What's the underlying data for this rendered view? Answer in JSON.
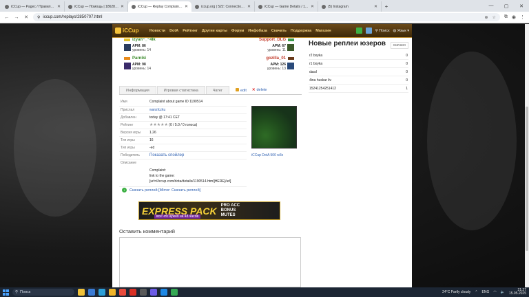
{
  "browser": {
    "tabs": [
      {
        "title": "iCCup — Pagec / Правила игр...",
        "active": false
      },
      {
        "title": "iCCup — Помощь | 1862858",
        "active": false
      },
      {
        "title": "iCCup — Replay Complaint ab...",
        "active": true
      },
      {
        "title": "iccup.org | 522: Connection tim...",
        "active": false
      },
      {
        "title": "iCCup — Game Details / 1190...",
        "active": false
      },
      {
        "title": "(5) Instagram",
        "active": false
      }
    ],
    "url": "iccup.com/replays/2850707.html"
  },
  "site": {
    "logo": "iCCup",
    "nav": [
      "Новости",
      "DotA",
      "Рейтинг",
      "Другие карты",
      "Форум",
      "Инфобаза",
      "Скачать",
      "Поддержка",
      "Магазин"
    ],
    "search_label": "Поиск",
    "lang_label": "Язык"
  },
  "players": {
    "left": [
      {
        "name": "izyan~_~4lk",
        "apm": "APM: 86",
        "level": "уровень: 14"
      },
      {
        "name": "Parniki",
        "apm": "APM: 98",
        "level": "уровень: 14"
      }
    ],
    "right": [
      {
        "name": "Support_DLG",
        "apm": "APM: 67",
        "level": "уровень: 11"
      },
      {
        "name": "gozilla_01",
        "apm": "APM: 126",
        "level": "уровень: 13"
      }
    ]
  },
  "tabs": {
    "info": "Информация",
    "stats": "Игровая статистика",
    "chat": "Чатег",
    "edit": "edit",
    "delete": "delete"
  },
  "details": {
    "rows": [
      {
        "k": "Имя",
        "v": "Complaint about game ID 1190514"
      },
      {
        "k": "Прислал",
        "v": "wanzfczku"
      },
      {
        "k": "Добавлен",
        "v": "today @ 17:41 CET"
      },
      {
        "k": "Рейтинг",
        "v": "(0 / 5.0 / 0 голоса)"
      },
      {
        "k": "Версия игры",
        "v": "1.26"
      },
      {
        "k": "Тип игры",
        "v": "16"
      },
      {
        "k": "Тип игры",
        "v": "-ed"
      }
    ],
    "winner_label": "Победитель",
    "winner_value": "Показать спойлер",
    "desc_label": "Описание",
    "desc_lines": [
      "Complaint:",
      "link to the game:",
      "[url=//iccup.com/dota/details/1190514.html]HERE[/url]"
    ],
    "map_label": "iCCup DotA 500 w3x"
  },
  "download": "Скачать реплей [Mirror: Скачать реплей]",
  "banner": {
    "big": "EXPRESS PACK",
    "side": [
      "PRO ACC",
      "BONUS",
      "MUTES"
    ],
    "sub": "все что нужно на 48 часов"
  },
  "comment_heading": "Оставить комментарий",
  "sidebar": {
    "title": "Новые реплеи юзеров",
    "button": "скачано",
    "items": [
      {
        "name": "r2 boyka",
        "count": "0"
      },
      {
        "name": "r1 boyka",
        "count": "0"
      },
      {
        "name": "dasd",
        "count": "0"
      },
      {
        "name": "4ina huskar liv",
        "count": "0"
      },
      {
        "name": "15241254251412",
        "count": "1"
      }
    ]
  },
  "taskbar": {
    "search": "Поиск",
    "weather": "24°C  Partly cloudy",
    "lang": "ENG",
    "time": "21:27",
    "date": "15.05.2025"
  }
}
